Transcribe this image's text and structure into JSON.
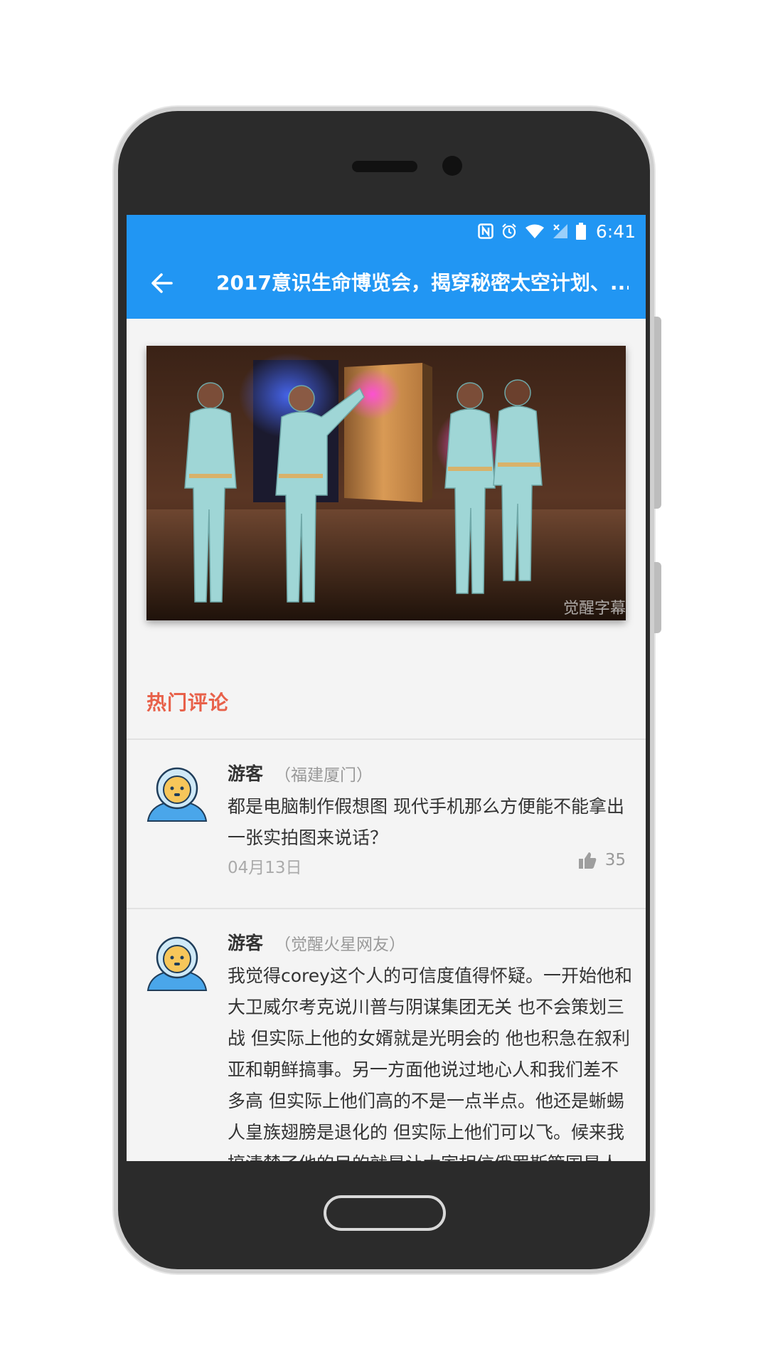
{
  "status_bar": {
    "time": "6:41",
    "icons": [
      "nfc-icon",
      "alarm-icon",
      "wifi-icon",
      "signal-off-icon",
      "battery-icon"
    ]
  },
  "app_bar": {
    "back_icon": "arrow-back-icon",
    "title": "2017意识生命博览会，揭穿秘密太空计划、..."
  },
  "hero_image": {
    "watermark": "觉醒字幕组"
  },
  "comments_section": {
    "title": "热门评论",
    "comments": [
      {
        "author": "游客",
        "location": "（福建厦门）",
        "text": "都是电脑制作假想图 现代手机那么方便能不能拿出一张实拍图来说话？",
        "date": "04月13日",
        "likes": "35"
      },
      {
        "author": "游客",
        "location": "（觉醒火星网友）",
        "text": "我觉得corey这个人的可信度值得怀疑。一开始他和大卫威尔考克说川普与阴谋集团无关 也不会策划三战 但实际上他的女婿就是光明会的 他也积急在叙利亚和朝鲜搞事。另一方面他说过地心人和我们差不多高 但实际上他们高的不是一点半点。他还是蜥蜴人皇族翅膀是退化的 但实际上他们可以飞。候来我搞清楚了他的目的就是让大家相信俄罗斯策国是人"
      }
    ]
  },
  "colors": {
    "primary": "#2196f3",
    "accent": "#e8614a",
    "background": "#f4f4f4"
  }
}
